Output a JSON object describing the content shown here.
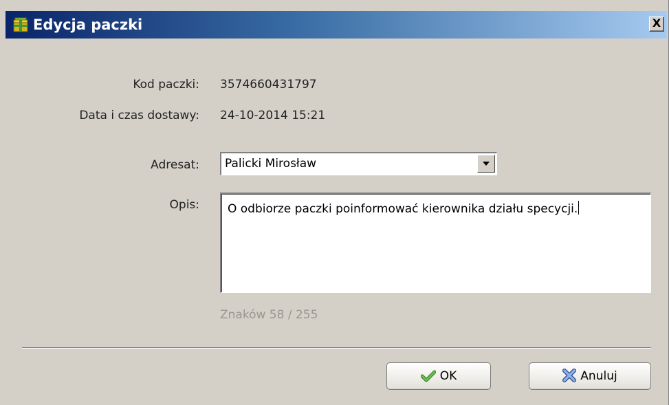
{
  "window": {
    "title": "Edycja paczki",
    "close_glyph": "X",
    "icon": "package-icon"
  },
  "fields": {
    "package_code_label": "Kod paczki:",
    "package_code_value": "3574660431797",
    "delivery_label": "Data i czas dostawy:",
    "delivery_value": "24-10-2014 15:21",
    "recipient_label": "Adresat:",
    "recipient_selected": "Palicki Mirosław",
    "description_label": "Opis:",
    "description_value": "O odbiorze paczki poinformować kierownika działu specycji.",
    "char_counter": "Znaków 58 / 255"
  },
  "buttons": {
    "ok_label": "OK",
    "ok_icon": "checkmark-icon",
    "cancel_label": "Anuluj",
    "cancel_icon": "x-icon"
  },
  "colors": {
    "title_gradient_start": "#0a246a",
    "title_gradient_end": "#a6caf0",
    "dialog_bg": "#d4d0c8",
    "ok_icon": "#3aa53a",
    "cancel_icon": "#5a7fc8"
  }
}
